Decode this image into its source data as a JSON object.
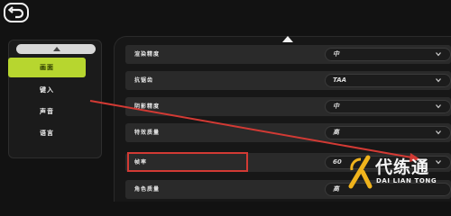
{
  "nav": {
    "items": [
      {
        "label": "画面",
        "active": true
      },
      {
        "label": "键入",
        "active": false
      },
      {
        "label": "声音",
        "active": false
      },
      {
        "label": "语言",
        "active": false
      }
    ]
  },
  "settings": {
    "rows": [
      {
        "label": "渲染精度",
        "value": "中"
      },
      {
        "label": "抗锯齿",
        "value": "TAA"
      },
      {
        "label": "阴影精度",
        "value": "中"
      },
      {
        "label": "特效质量",
        "value": "高"
      },
      {
        "label": "帧率",
        "value": "60"
      },
      {
        "label": "角色质量",
        "value": "高"
      }
    ]
  },
  "watermark": {
    "title": "代练通",
    "subtitle": "DAI LIAN TONG"
  },
  "colors": {
    "accent": "#b7d62f",
    "annotation": "#d23a34",
    "watermark_logo": "#f0b31c"
  }
}
